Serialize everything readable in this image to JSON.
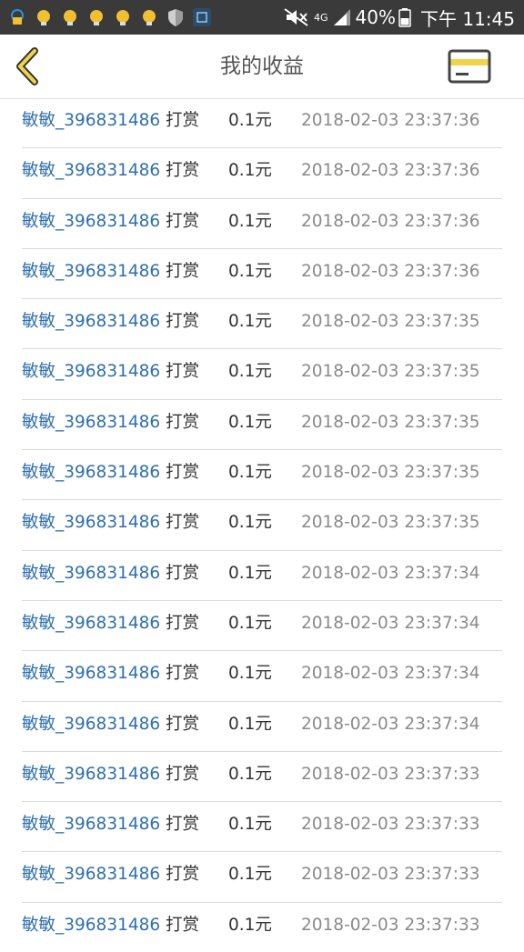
{
  "status_bar": {
    "network": "4G",
    "battery": "40%",
    "time": "下午 11:45"
  },
  "header": {
    "title": "我的收益"
  },
  "colors": {
    "link": "#2f6fb0",
    "accent_yellow": "#f0d34a",
    "status_bar_bg": "#3a3a3a"
  },
  "records": [
    {
      "user": "敏敏_396831486",
      "action": "打赏",
      "amount": "0.1元",
      "time": "2018-02-03 23:37:36"
    },
    {
      "user": "敏敏_396831486",
      "action": "打赏",
      "amount": "0.1元",
      "time": "2018-02-03 23:37:36"
    },
    {
      "user": "敏敏_396831486",
      "action": "打赏",
      "amount": "0.1元",
      "time": "2018-02-03 23:37:36"
    },
    {
      "user": "敏敏_396831486",
      "action": "打赏",
      "amount": "0.1元",
      "time": "2018-02-03 23:37:36"
    },
    {
      "user": "敏敏_396831486",
      "action": "打赏",
      "amount": "0.1元",
      "time": "2018-02-03 23:37:35"
    },
    {
      "user": "敏敏_396831486",
      "action": "打赏",
      "amount": "0.1元",
      "time": "2018-02-03 23:37:35"
    },
    {
      "user": "敏敏_396831486",
      "action": "打赏",
      "amount": "0.1元",
      "time": "2018-02-03 23:37:35"
    },
    {
      "user": "敏敏_396831486",
      "action": "打赏",
      "amount": "0.1元",
      "time": "2018-02-03 23:37:35"
    },
    {
      "user": "敏敏_396831486",
      "action": "打赏",
      "amount": "0.1元",
      "time": "2018-02-03 23:37:35"
    },
    {
      "user": "敏敏_396831486",
      "action": "打赏",
      "amount": "0.1元",
      "time": "2018-02-03 23:37:34"
    },
    {
      "user": "敏敏_396831486",
      "action": "打赏",
      "amount": "0.1元",
      "time": "2018-02-03 23:37:34"
    },
    {
      "user": "敏敏_396831486",
      "action": "打赏",
      "amount": "0.1元",
      "time": "2018-02-03 23:37:34"
    },
    {
      "user": "敏敏_396831486",
      "action": "打赏",
      "amount": "0.1元",
      "time": "2018-02-03 23:37:34"
    },
    {
      "user": "敏敏_396831486",
      "action": "打赏",
      "amount": "0.1元",
      "time": "2018-02-03 23:37:33"
    },
    {
      "user": "敏敏_396831486",
      "action": "打赏",
      "amount": "0.1元",
      "time": "2018-02-03 23:37:33"
    },
    {
      "user": "敏敏_396831486",
      "action": "打赏",
      "amount": "0.1元",
      "time": "2018-02-03 23:37:33"
    },
    {
      "user": "敏敏_396831486",
      "action": "打赏",
      "amount": "0.1元",
      "time": "2018-02-03 23:37:33"
    }
  ]
}
